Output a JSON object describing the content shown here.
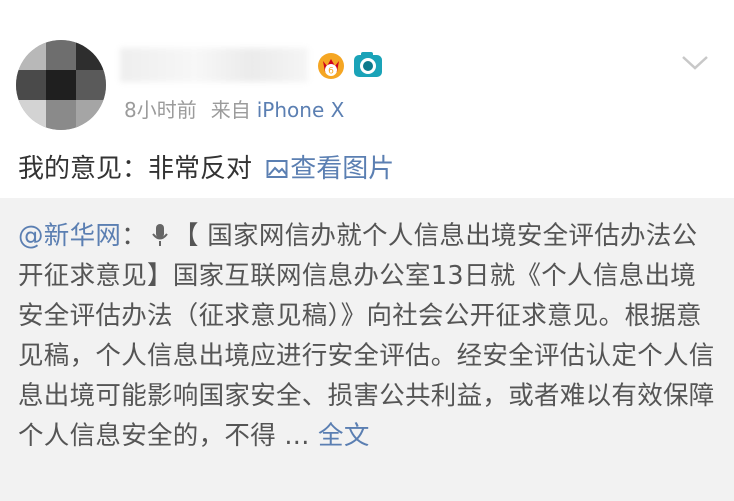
{
  "post": {
    "time": "8小时前",
    "source_prefix": "来自",
    "device": "iPhone X",
    "text": "我的意见：非常反对",
    "view_image_label": "查看图片"
  },
  "icons": {
    "badges": [
      "crown-badge-icon",
      "camera-badge-icon"
    ],
    "menu": "chevron-down-icon",
    "image": "picture-icon"
  },
  "repost": {
    "mention": "@新华网",
    "colon": "：",
    "title": "【 国家网信办就个人信息出境安全评估办法公开征求意见】",
    "body": "国家互联网信息办公室13日就《个人信息出境安全评估办法（征求意见稿）》向社会公开征求意见。根据意见稿，个人信息出境应进行安全评估。经安全评估认定个人信息出境可能影响国家安全、损害公共利益，或者难以有效保障个人信息安全的，不得 ...",
    "full_text_label": "全文"
  },
  "colors": {
    "link": "#5b7fb2",
    "meta": "#9b9b9b",
    "repost_bg": "#f2f2f2"
  }
}
